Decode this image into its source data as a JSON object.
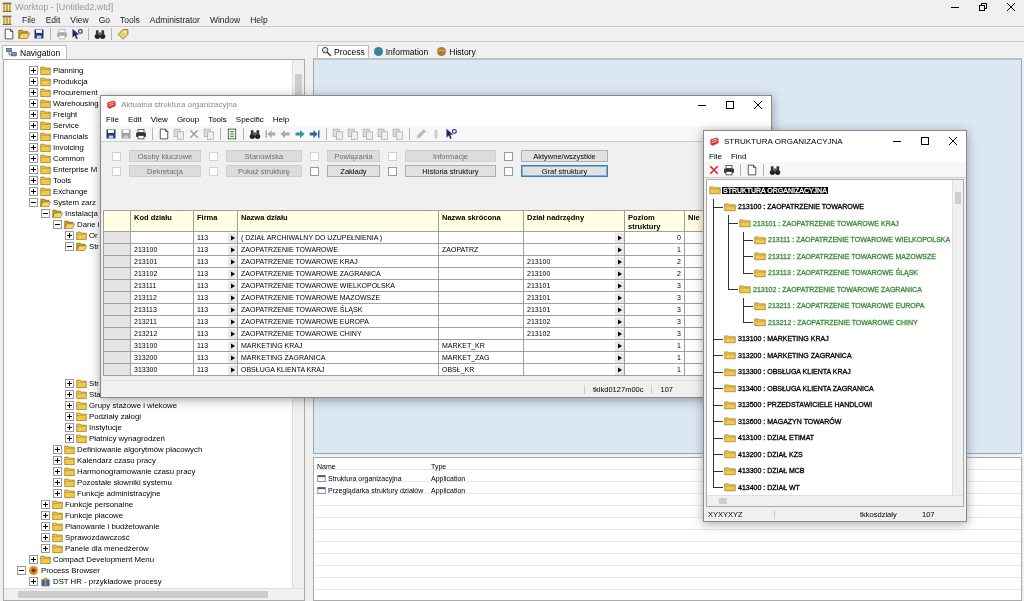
{
  "app": {
    "title": "Worktop - [Untitled2.wtd]",
    "menu": [
      "File",
      "Edit",
      "View",
      "Go",
      "Tools",
      "Administrator",
      "Window",
      "Help"
    ]
  },
  "navigation": {
    "tab": "Navigation",
    "branch_items": [
      {
        "label": "Planning",
        "expanded": false
      },
      {
        "label": "Produkcja",
        "expanded": false
      },
      {
        "label": "Procurement",
        "expanded": false
      },
      {
        "label": "Warehousing",
        "expanded": false
      },
      {
        "label": "Freight",
        "expanded": false
      },
      {
        "label": "Service",
        "expanded": false
      },
      {
        "label": "Financials",
        "expanded": false
      },
      {
        "label": "Invoicing",
        "expanded": false
      },
      {
        "label": "Common",
        "expanded": false
      },
      {
        "label": "Enterprise M",
        "expanded": false
      },
      {
        "label": "Tools",
        "expanded": false
      },
      {
        "label": "Exchange",
        "expanded": false
      },
      {
        "label": "System zarz",
        "expanded": true,
        "children": [
          {
            "label": "Instalacja",
            "expanded": true,
            "children": [
              {
                "label": "Dane i",
                "expanded": true,
                "children": [
                  {
                    "label": "Or",
                    "expanded": false
                  },
                  {
                    "label": "Str",
                    "expanded": true
                  },
                  {
                    "label": "Str",
                    "expanded": false
                  },
                  {
                    "label": "Sta",
                    "expanded": false
                  },
                  {
                    "label": "Grupy stażowe i wiekowe",
                    "expanded": false
                  },
                  {
                    "label": "Podziały załogi",
                    "expanded": false
                  },
                  {
                    "label": "Instytucje",
                    "expanded": false
                  },
                  {
                    "label": "Płatnicy wynagrodzeń",
                    "expanded": false
                  }
                ]
              },
              {
                "label": "Definiowanie algorytmów płacowych",
                "expanded": false
              },
              {
                "label": "Kalendarz czasu pracy",
                "expanded": false
              },
              {
                "label": "Harmonogramowanie czasu pracy",
                "expanded": false
              },
              {
                "label": "Pozostałe słowniki systemu",
                "expanded": false
              },
              {
                "label": "Funkcje administracyjne",
                "expanded": false
              }
            ]
          },
          {
            "label": "Funkcje personalne",
            "expanded": false
          },
          {
            "label": "Funkcje płacowe",
            "expanded": false
          },
          {
            "label": "Planowanie i budżetowanie",
            "expanded": false
          },
          {
            "label": "Sprawozdawczość",
            "expanded": false
          },
          {
            "label": "Panele dla menedżerów",
            "expanded": false
          }
        ]
      },
      {
        "label": "Compact Development Menu",
        "expanded": false
      }
    ],
    "root_items": [
      {
        "label": "Process Browser",
        "kind": "process",
        "expanded": true,
        "children": [
          {
            "label": "DST HR - przykładowe procesy",
            "kind": "package",
            "expanded": false
          }
        ]
      }
    ]
  },
  "tabs": [
    {
      "label": "Process",
      "selected": true
    },
    {
      "label": "Information",
      "selected": false
    },
    {
      "label": "History",
      "selected": false
    }
  ],
  "object_list": {
    "columns": [
      "Name",
      "Type"
    ],
    "rows": [
      {
        "name": "Struktura organizacyjna",
        "type": "Application"
      },
      {
        "name": "Przeglądarka struktury działów",
        "type": "Application"
      }
    ]
  },
  "structure_window": {
    "title": "Aktualna struktura organizacyjna",
    "menu": [
      "File",
      "Edit",
      "View",
      "Group",
      "Tools",
      "Specific",
      "Help"
    ],
    "buttons": [
      {
        "label": "Osoby kluczowe",
        "checked": false,
        "disabled": true,
        "focused": false
      },
      {
        "label": "Stanowiska",
        "checked": false,
        "disabled": true,
        "focused": false
      },
      {
        "label": "Powiązania",
        "checked": false,
        "disabled": true,
        "focused": false
      },
      {
        "label": "Informacje",
        "checked": false,
        "disabled": true,
        "focused": false
      },
      {
        "label": "Aktywne/wszystkie",
        "checked": false,
        "disabled": false,
        "focused": false
      },
      {
        "label": "Dekretacja",
        "checked": false,
        "disabled": true,
        "focused": false
      },
      {
        "label": "Pokaż strukturę",
        "checked": false,
        "disabled": true,
        "focused": false
      },
      {
        "label": "Zakłady",
        "checked": false,
        "disabled": false,
        "focused": false
      },
      {
        "label": "Historia struktury",
        "checked": false,
        "disabled": false,
        "focused": false
      },
      {
        "label": "Graf struktury",
        "checked": false,
        "disabled": false,
        "focused": true
      }
    ],
    "table": {
      "columns": [
        "Kod działu",
        "Firma",
        "Nazwa działu",
        "Nazwa skrócona",
        "Dział nadrzędny",
        "Poziom struktury",
        "Nie"
      ],
      "rows": [
        {
          "firm": "113",
          "name": "( DZIAŁ ARCHIWALNY DO UZUPEŁNIENIA )",
          "structure_level": "0"
        },
        {
          "code": "213100",
          "firm": "113",
          "name": "ZAOPATRZENIE TOWAROWE",
          "short": "ZAOPATRZ",
          "structure_level": "1"
        },
        {
          "code": "213101",
          "firm": "113",
          "name": "ZAOPATRZENIE TOWAROWE KRAJ",
          "parent": "213100",
          "structure_level": "2"
        },
        {
          "code": "213102",
          "firm": "113",
          "name": "ZAOPATRZENIE TOWAROWE ZAGRANICA",
          "parent": "213100",
          "structure_level": "2"
        },
        {
          "code": "213111",
          "firm": "113",
          "name": "ZAOPATRZENIE TOWAROWE WIELKOPOLSKA",
          "parent": "213101",
          "structure_level": "3"
        },
        {
          "code": "213112",
          "firm": "113",
          "name": "ZAOPATRZENIE TOWAROWE MAZOWSZE",
          "parent": "213101",
          "structure_level": "3"
        },
        {
          "code": "213113",
          "firm": "113",
          "name": "ZAOPATRZENIE TOWAROWE ŚLĄSK",
          "parent": "213101",
          "structure_level": "3"
        },
        {
          "code": "213211",
          "firm": "113",
          "name": "ZAOPATRZENIE TOWAROWE EUROPA",
          "parent": "213102",
          "structure_level": "3"
        },
        {
          "code": "213212",
          "firm": "113",
          "name": "ZAOPATRZENIE TOWAROWE CHINY",
          "parent": "213102",
          "structure_level": "3"
        },
        {
          "code": "313100",
          "firm": "113",
          "name": "MARKETING KRAJ",
          "short": "MARKET_KR",
          "structure_level": "1"
        },
        {
          "code": "313200",
          "firm": "113",
          "name": "MARKETING ZAGRANICA",
          "short": "MARKET_ZAG",
          "structure_level": "1"
        },
        {
          "code": "313300",
          "firm": "113",
          "name": "OBSŁUGA KLIENTA KRAJ",
          "short": "OBSŁ_KR",
          "structure_level": "1"
        }
      ]
    },
    "status": [
      "tkikd0127m00c",
      "107"
    ]
  },
  "chart_window": {
    "title": "STRUKTURA ORGANIZACYJNA",
    "menu": [
      "File",
      "Find"
    ],
    "tree": [
      {
        "label": "STRUKTURA ORGANIZACYJNA",
        "selected": true,
        "children": [
          {
            "label": "213100 : ZAOPATRZENIE TOWAROWE",
            "selected": false,
            "color": "#000000",
            "children": [
              {
                "label": "213101  : ZAOPATRZENIE TOWAROWE KRAJ",
                "selected": false,
                "color": "#3d8b3d",
                "children": [
                  {
                    "label": "213111  : ZAOPATRZENIE TOWAROWE WIELKOPOLSKA",
                    "selected": false,
                    "color": "#3d8b3d"
                  },
                  {
                    "label": "213112  : ZAOPATRZENIE TOWAROWE MAZOWSZE",
                    "selected": false,
                    "color": "#3d8b3d"
                  },
                  {
                    "label": "213113  : ZAOPATRZENIE TOWAROWE ŚLĄSK",
                    "selected": false,
                    "color": "#3d8b3d"
                  }
                ]
              },
              {
                "label": "213102  : ZAOPATRZENIE TOWAROWE ZAGRANICA",
                "selected": false,
                "color": "#3d8b3d",
                "children": [
                  {
                    "label": "213211  : ZAOPATRZENIE TOWAROWE EUROPA",
                    "selected": false,
                    "color": "#3d8b3d"
                  },
                  {
                    "label": "213212  : ZAOPATRZENIE TOWAROWE CHINY",
                    "selected": false,
                    "color": "#3d8b3d"
                  }
                ]
              }
            ]
          },
          {
            "label": "313100 : MARKETING KRAJ",
            "selected": false,
            "color": "#000000"
          },
          {
            "label": "313200 : MARKETING ZAGRANICA",
            "selected": false,
            "color": "#000000"
          },
          {
            "label": "313300 : OBSŁUGA KLIENTA KRAJ",
            "selected": false,
            "color": "#000000"
          },
          {
            "label": "313400 : OBSŁUGA KLIENTA ZAGRANICA",
            "selected": false,
            "color": "#000000"
          },
          {
            "label": "313500 : PRZEDSTAWICIELE HANDLOWI",
            "selected": false,
            "color": "#000000"
          },
          {
            "label": "313600 : MAGAZYN TOWARÓW",
            "selected": false,
            "color": "#000000"
          },
          {
            "label": "413100 : DZIAŁ ETIMAT",
            "selected": false,
            "color": "#000000"
          },
          {
            "label": "413200 : DZIAŁ KZS",
            "selected": false,
            "color": "#000000"
          },
          {
            "label": "413300 : DZIAŁ MCB",
            "selected": false,
            "color": "#000000"
          },
          {
            "label": "413400 : DZIAŁ WT",
            "selected": false,
            "color": "#000000"
          }
        ]
      }
    ],
    "status": [
      "XYXYXYZ",
      "tkkosdziały",
      "107"
    ]
  }
}
